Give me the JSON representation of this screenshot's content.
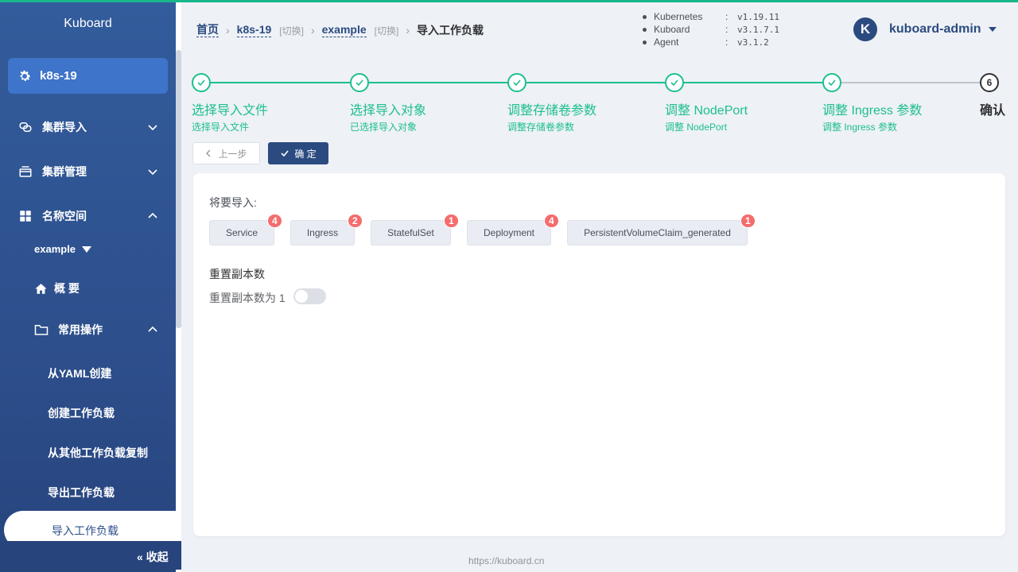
{
  "sidebar": {
    "title": "Kuboard",
    "cluster": "k8s-19",
    "menu_cluster_import": "集群导入",
    "menu_cluster_manage": "集群管理",
    "menu_namespace": "名称空间",
    "namespace": "example",
    "overview": "概 要",
    "common_ops": "常用操作",
    "sub_items": [
      "从YAML创建",
      "创建工作负载",
      "从其他工作负载复制",
      "导出工作负载"
    ],
    "active_item": "导入工作负载",
    "collapse": "收起"
  },
  "breadcrumb": {
    "home": "首页",
    "cluster": "k8s-19",
    "switch": "[切换]",
    "namespace": "example",
    "current": "导入工作负载"
  },
  "versions": [
    {
      "name": "Kubernetes",
      "value": "v1.19.11"
    },
    {
      "name": "Kuboard",
      "value": "v3.1.7.1"
    },
    {
      "name": "Agent",
      "value": "v3.1.2"
    }
  ],
  "user": {
    "initial": "K",
    "name": "kuboard-admin"
  },
  "steps": [
    {
      "title": "选择导入文件",
      "desc": "选择导入文件"
    },
    {
      "title": "选择导入对象",
      "desc": "已选择导入对象"
    },
    {
      "title": "调整存储卷参数",
      "desc": "调整存储卷参数"
    },
    {
      "title": "调整 NodePort",
      "desc": "调整 NodePort"
    },
    {
      "title": "调整 Ingress 参数",
      "desc": "调整 Ingress 参数"
    },
    {
      "title": "确认",
      "number": "6"
    }
  ],
  "buttons": {
    "prev": "上一步",
    "confirm": "确 定"
  },
  "import": {
    "label": "将要导入:",
    "resources": [
      {
        "name": "Service",
        "count": "4"
      },
      {
        "name": "Ingress",
        "count": "2"
      },
      {
        "name": "StatefulSet",
        "count": "1"
      },
      {
        "name": "Deployment",
        "count": "4"
      },
      {
        "name": "PersistentVolumeClaim_generated",
        "count": "1"
      }
    ]
  },
  "replica": {
    "title": "重置副本数",
    "label": "重置副本数为 1",
    "enabled": false
  },
  "footer": "https://kuboard.cn",
  "colors": {
    "primary": "#2b4b80",
    "success": "#1cbf8e",
    "badge": "#f56c6c",
    "sidebar": "#2d4f8c"
  }
}
